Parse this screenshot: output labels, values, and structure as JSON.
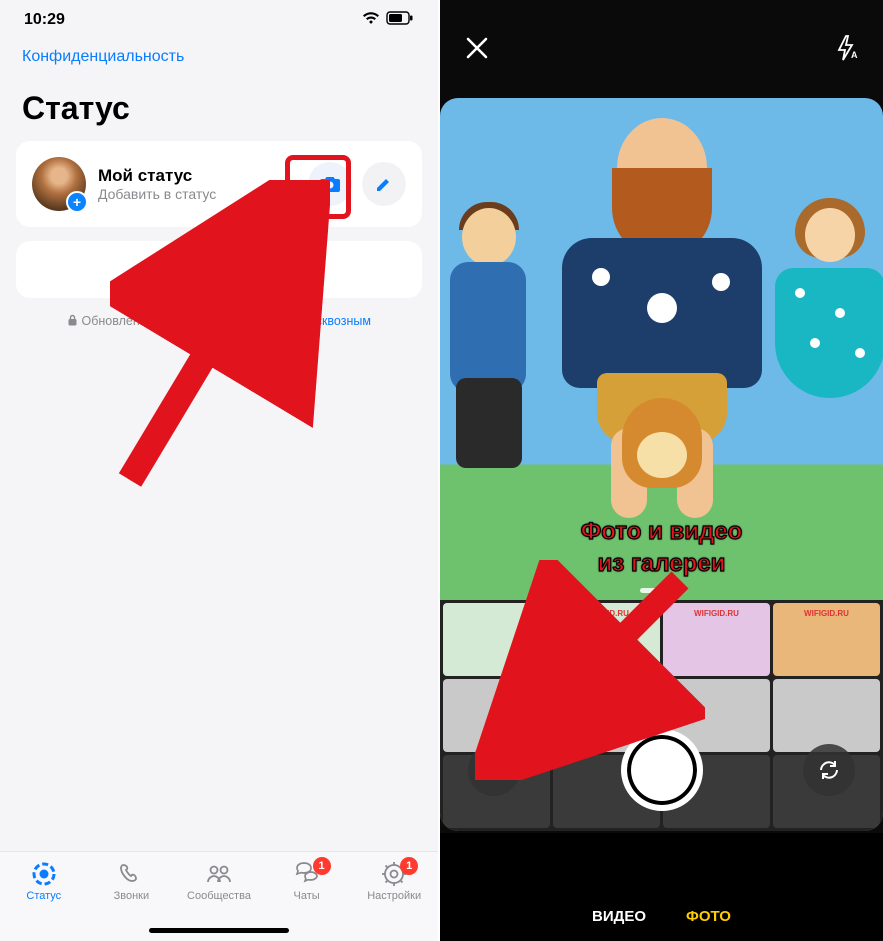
{
  "statusbar": {
    "time": "10:29"
  },
  "privacy": "Конфиденциальность",
  "title": "Статус",
  "my_status": {
    "title": "Мой статус",
    "subtitle": "Добавить в статус"
  },
  "empty_msg": "Нет недавних статусов.",
  "e2e": {
    "prefix": "Обновления вашего статуса защищены ",
    "link": "сквозным шифрованием"
  },
  "tabs": {
    "status": "Статус",
    "calls": "Звонки",
    "communities": "Сообщества",
    "chats": "Чаты",
    "settings": "Настройки",
    "chats_badge": "1",
    "settings_badge": "1"
  },
  "overlay": {
    "line1": "Фото и видео",
    "line2": "из галереи"
  },
  "thumbs": {
    "label": "WIFIGID.RU"
  },
  "camera_modes": {
    "video": "ВИДЕО",
    "photo": "ФОТО"
  },
  "colors": {
    "accent": "#0a7cff",
    "red": "#e1131d",
    "yellow": "#ffcc00"
  }
}
